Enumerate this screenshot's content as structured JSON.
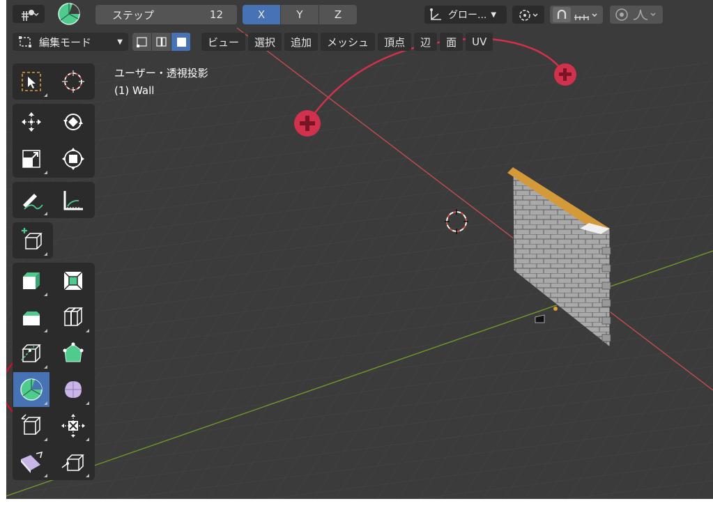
{
  "header": {
    "step_label": "ステップ",
    "step_value": "12",
    "axes": [
      "X",
      "Y",
      "Z"
    ],
    "active_axis": "X",
    "transform_orientation": "グロー...",
    "mode": "編集モード",
    "menu": [
      "ビュー",
      "選択",
      "追加",
      "メッシュ",
      "頂点",
      "辺",
      "面",
      "UV"
    ]
  },
  "viewport": {
    "view_name": "ユーザー・透視投影",
    "object_label": "(1) Wall"
  },
  "colors": {
    "accent": "#4772b3",
    "x_axis": "#c44d4d",
    "y_axis": "#6e9a2a",
    "gizmo_red": "#d0314c",
    "spin_tool": "#4ecb8d"
  },
  "toolbar": {
    "tools": [
      "select-box-icon",
      "cursor-icon",
      "move-icon",
      "rotate-icon",
      "scale-icon",
      "transform-icon",
      "annotate-icon",
      "measure-icon",
      "add-cube-icon",
      "extrude-region-icon",
      "inset-faces-icon",
      "bevel-icon",
      "loop-cut-icon",
      "knife-icon",
      "poly-build-icon",
      "spin-icon",
      "smooth-icon",
      "edge-slide-icon",
      "shrink-fatten-icon",
      "shear-icon",
      "rip-region-icon"
    ],
    "active_tool": "spin-icon"
  }
}
